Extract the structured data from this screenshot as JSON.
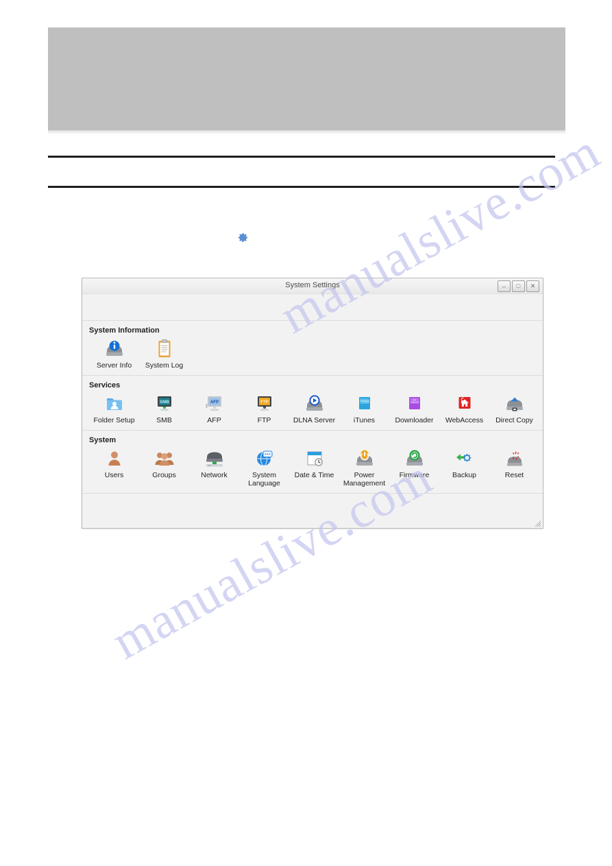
{
  "page": {
    "watermark_text": "manualslive.com"
  },
  "inline_icon": {
    "name": "gear-icon"
  },
  "window": {
    "title": "System Settings",
    "controls": [
      {
        "name": "minimize-button",
        "glyph": "–"
      },
      {
        "name": "maximize-button",
        "glyph": "□"
      },
      {
        "name": "close-button",
        "glyph": "✕"
      }
    ],
    "resize_grip": "resize-grip"
  },
  "sections": [
    {
      "title": "System Information",
      "items": [
        {
          "label": "Server Info",
          "icon": "server-info-icon"
        },
        {
          "label": "System Log",
          "icon": "system-log-icon"
        }
      ]
    },
    {
      "title": "Services",
      "items": [
        {
          "label": "Folder Setup",
          "icon": "folder-setup-icon"
        },
        {
          "label": "SMB",
          "icon": "smb-icon"
        },
        {
          "label": "AFP",
          "icon": "afp-icon"
        },
        {
          "label": "FTP",
          "icon": "ftp-icon"
        },
        {
          "label": "DLNA Server",
          "icon": "dlna-server-icon"
        },
        {
          "label": "iTunes",
          "icon": "itunes-icon"
        },
        {
          "label": "Downloader",
          "icon": "downloader-icon"
        },
        {
          "label": "WebAccess",
          "icon": "webaccess-icon"
        },
        {
          "label": "Direct Copy",
          "icon": "direct-copy-icon"
        }
      ]
    },
    {
      "title": "System",
      "items": [
        {
          "label": "Users",
          "icon": "users-icon"
        },
        {
          "label": "Groups",
          "icon": "groups-icon"
        },
        {
          "label": "Network",
          "icon": "network-icon"
        },
        {
          "label": "System Language",
          "icon": "system-language-icon"
        },
        {
          "label": "Date & Time",
          "icon": "date-time-icon"
        },
        {
          "label": "Power Management",
          "icon": "power-management-icon"
        },
        {
          "label": "Firmware",
          "icon": "firmware-icon"
        },
        {
          "label": "Backup",
          "icon": "backup-icon"
        },
        {
          "label": "Reset",
          "icon": "reset-icon"
        }
      ]
    }
  ],
  "colors": {
    "banner": "#bfbfbf",
    "rule": "#1d1d1d",
    "window_bg": "#f2f2f2",
    "accent_blue": "#5b8fd4",
    "watermark": "#c3c6ee"
  }
}
